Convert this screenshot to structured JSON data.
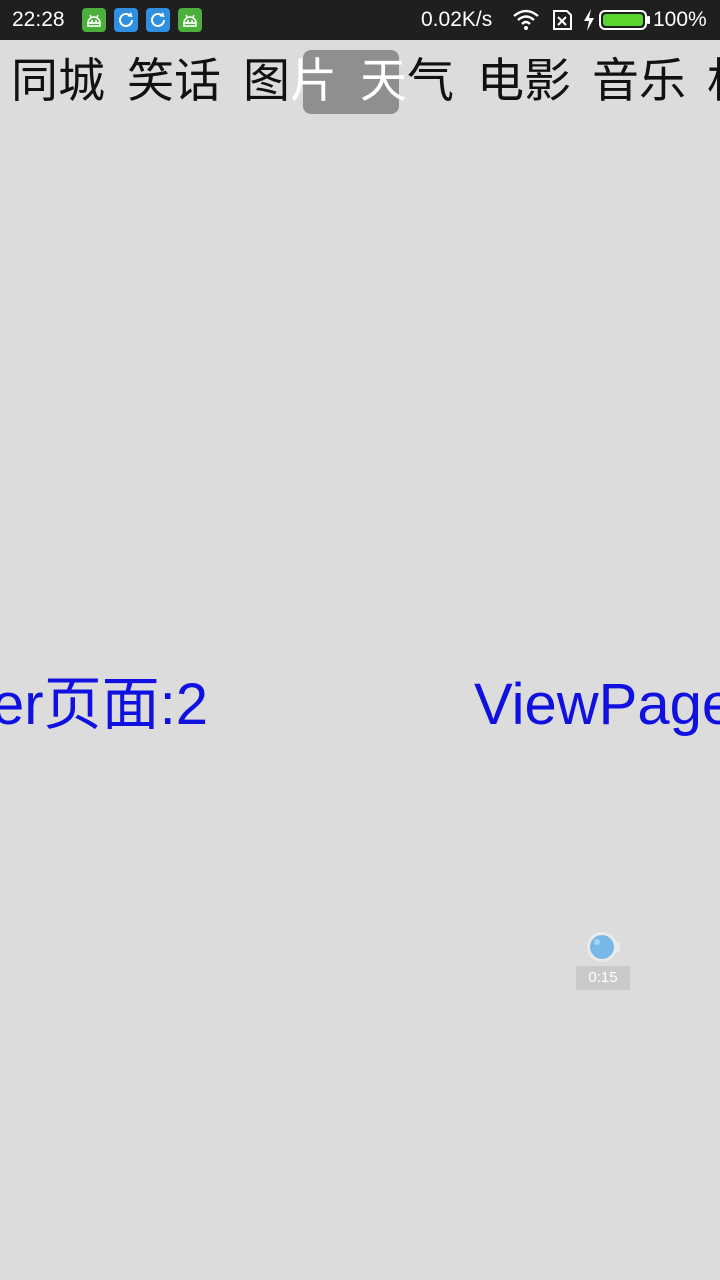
{
  "status_bar": {
    "time": "22:28",
    "network_speed": "0.02K/s",
    "battery_level": "100%",
    "notification_icons": [
      "android-app-icon",
      "sync-icon",
      "sync-icon",
      "android-app-icon"
    ]
  },
  "tabs": [
    {
      "label": "同城",
      "selected": false
    },
    {
      "label": "笑话",
      "selected": false
    },
    {
      "label": "图片",
      "selected": false
    },
    {
      "label": "天气",
      "selected": true
    },
    {
      "label": "电影",
      "selected": false
    },
    {
      "label": "音乐",
      "selected": false
    },
    {
      "label": "相",
      "selected": false
    }
  ],
  "pager": {
    "previous_page_text": "er页面:2",
    "next_page_text": "ViewPage"
  },
  "recorder": {
    "elapsed": "0:15"
  },
  "colors": {
    "background": "#dcdcdc",
    "status_bar": "#1f1f1f",
    "tab_highlight": "#8f8f8f",
    "pager_text": "#1010e0",
    "notif_green": "#4caf3c",
    "notif_blue": "#2f8fe0",
    "battery_green": "#5cd62e"
  }
}
